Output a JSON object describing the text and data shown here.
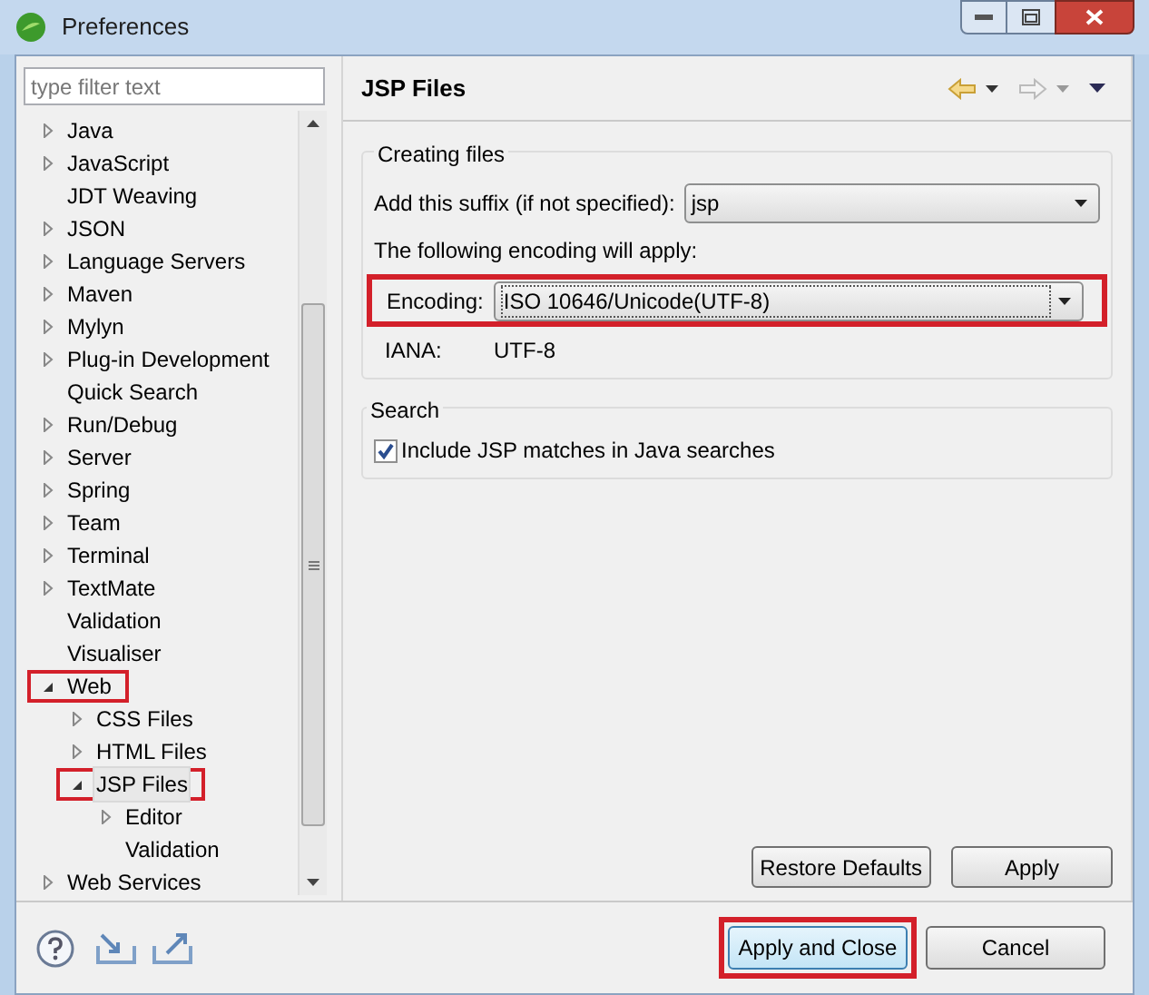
{
  "window": {
    "title": "Preferences"
  },
  "filter": {
    "placeholder": "type filter text"
  },
  "tree": [
    {
      "label": "Java",
      "kind": "folder",
      "expanded": false,
      "selected": false,
      "highlighted": false
    },
    {
      "label": "JavaScript",
      "kind": "folder",
      "expanded": false,
      "selected": false,
      "highlighted": false
    },
    {
      "label": "JDT Weaving",
      "kind": "leaf",
      "selected": false,
      "highlighted": false
    },
    {
      "label": "JSON",
      "kind": "folder",
      "expanded": false,
      "selected": false,
      "highlighted": false
    },
    {
      "label": "Language Servers",
      "kind": "folder",
      "expanded": false,
      "selected": false,
      "highlighted": false
    },
    {
      "label": "Maven",
      "kind": "folder",
      "expanded": false,
      "selected": false,
      "highlighted": false
    },
    {
      "label": "Mylyn",
      "kind": "folder",
      "expanded": false,
      "selected": false,
      "highlighted": false
    },
    {
      "label": "Plug-in Development",
      "kind": "folder",
      "expanded": false,
      "selected": false,
      "highlighted": false
    },
    {
      "label": "Quick Search",
      "kind": "leaf",
      "selected": false,
      "highlighted": false
    },
    {
      "label": "Run/Debug",
      "kind": "folder",
      "expanded": false,
      "selected": false,
      "highlighted": false
    },
    {
      "label": "Server",
      "kind": "folder",
      "expanded": false,
      "selected": false,
      "highlighted": false
    },
    {
      "label": "Spring",
      "kind": "folder",
      "expanded": false,
      "selected": false,
      "highlighted": false
    },
    {
      "label": "Team",
      "kind": "folder",
      "expanded": false,
      "selected": false,
      "highlighted": false
    },
    {
      "label": "Terminal",
      "kind": "folder",
      "expanded": false,
      "selected": false,
      "highlighted": false
    },
    {
      "label": "TextMate",
      "kind": "folder",
      "expanded": false,
      "selected": false,
      "highlighted": false
    },
    {
      "label": "Validation",
      "kind": "leaf",
      "selected": false,
      "highlighted": false
    },
    {
      "label": "Visualiser",
      "kind": "leaf",
      "selected": false,
      "highlighted": false
    },
    {
      "label": "Web",
      "kind": "folder",
      "expanded": true,
      "selected": false,
      "highlighted": true,
      "children": [
        {
          "label": "CSS Files",
          "kind": "folder",
          "expanded": false,
          "selected": false,
          "highlighted": false
        },
        {
          "label": "HTML Files",
          "kind": "folder",
          "expanded": false,
          "selected": false,
          "highlighted": false
        },
        {
          "label": "JSP Files",
          "kind": "folder",
          "expanded": true,
          "selected": true,
          "highlighted": true,
          "children": [
            {
              "label": "Editor",
              "kind": "folder",
              "expanded": false,
              "selected": false,
              "highlighted": false
            },
            {
              "label": "Validation",
              "kind": "leaf",
              "selected": false,
              "highlighted": false
            }
          ]
        }
      ]
    },
    {
      "label": "Web Services",
      "kind": "folder",
      "expanded": false,
      "selected": false,
      "highlighted": false
    }
  ],
  "page": {
    "title": "JSP Files",
    "creating_files": {
      "title": "Creating files",
      "suffix_label": "Add this suffix (if not specified):",
      "suffix_value": "jsp",
      "encoding_note": "The following encoding will apply:",
      "encoding_label": "Encoding:",
      "encoding_value": "ISO 10646/Unicode(UTF-8)",
      "encoding_highlighted": true,
      "iana_label": "IANA:",
      "iana_value": "UTF-8"
    },
    "search": {
      "title": "Search",
      "option": "Include JSP matches in Java searches",
      "checked": true
    },
    "buttons": [
      "Restore Defaults",
      "Apply"
    ]
  },
  "footer_buttons": [
    {
      "label": "Apply and Close",
      "highlighted": true,
      "default": true
    },
    {
      "label": "Cancel",
      "highlighted": false,
      "default": false
    }
  ]
}
